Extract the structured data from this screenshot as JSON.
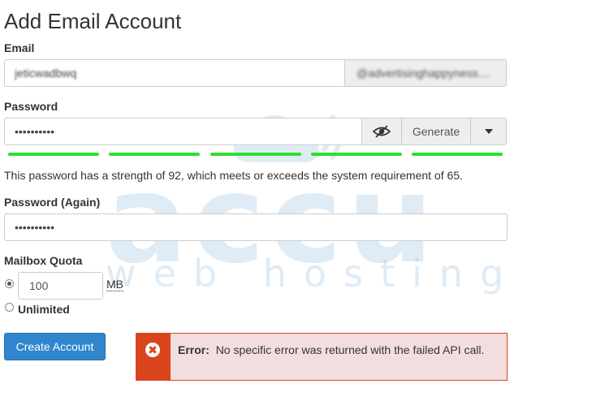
{
  "page": {
    "title": "Add Email Account"
  },
  "email": {
    "label": "Email",
    "value": "jeticwadbwq",
    "domain": "@advertisinghappyness...."
  },
  "password": {
    "label": "Password",
    "value": "••••••••••",
    "generate_label": "Generate",
    "strength_text": "This password has a strength of 92, which meets or exceeds the system requirement of 65."
  },
  "password_again": {
    "label": "Password (Again)",
    "value": "••••••••••"
  },
  "quota": {
    "label": "Mailbox Quota",
    "value": "100",
    "unit": "MB",
    "unlimited_label": "Unlimited"
  },
  "actions": {
    "create_label": "Create Account"
  },
  "alert": {
    "title": "Error:",
    "message": "No specific error was returned with the failed API call."
  },
  "watermark": {
    "brand": "accu",
    "tagline": "web hosting"
  },
  "colors": {
    "primary": "#2f86cd",
    "strength_bar": "#2ee02e",
    "error_border": "#d9441c",
    "error_bg": "#f2dede"
  }
}
